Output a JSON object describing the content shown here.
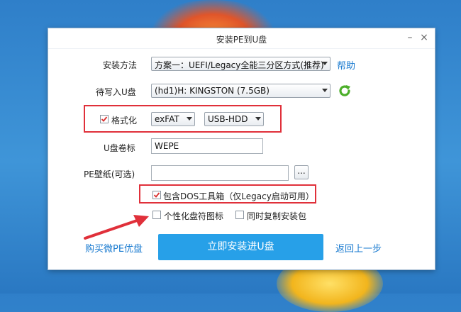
{
  "dialog": {
    "title": "安装PE到U盘",
    "minimize_label": "–",
    "close_label": "×"
  },
  "install_method": {
    "label": "安装方法",
    "selected": "方案一：UEFI/Legacy全能三分区方式(推荐)",
    "help_link": "帮助"
  },
  "target_disk": {
    "label": "待写入U盘",
    "selected": "(hd1)H: KINGSTON  (7.5GB)"
  },
  "format": {
    "checkbox_label": "格式化",
    "checked": true,
    "filesystem": "exFAT",
    "boot_mode": "USB-HDD"
  },
  "volume_label": {
    "label": "U盘卷标",
    "value": "WEPE"
  },
  "wallpaper": {
    "label": "PE壁纸(可选)",
    "value": "",
    "browse_label": "..."
  },
  "options": {
    "dos_tools": {
      "label": "包含DOS工具箱（仅Legacy启动可用）",
      "checked": true
    },
    "custom_icon": {
      "label": "个性化盘符图标",
      "checked": false
    },
    "copy_installer": {
      "label": "同时复制安装包",
      "checked": false
    }
  },
  "footer": {
    "buy_link": "购买微PE优盘",
    "install_button": "立即安装进U盘",
    "back_link": "返回上一步"
  },
  "colors": {
    "accent": "#27a0e8",
    "annotation_red": "#e0303a",
    "link": "#1a7bd0"
  }
}
